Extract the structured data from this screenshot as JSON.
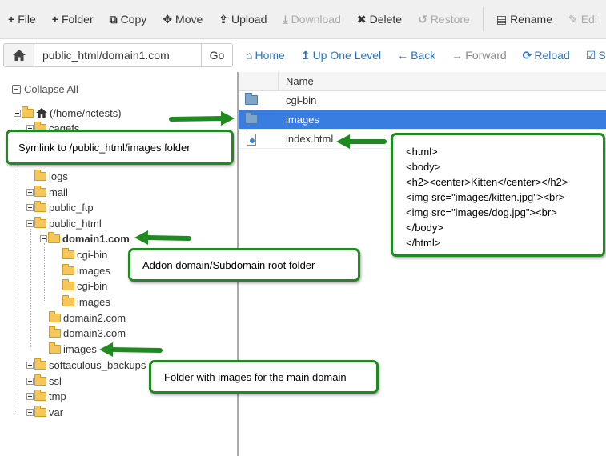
{
  "toolbar": {
    "file": "File",
    "folder": "Folder",
    "copy": "Copy",
    "move": "Move",
    "upload": "Upload",
    "download": "Download",
    "delete": "Delete",
    "restore": "Restore",
    "rename": "Rename",
    "edit": "Edi"
  },
  "address": {
    "path": "public_html/domain1.com",
    "go": "Go"
  },
  "nav": {
    "home": "Home",
    "up": "Up One Level",
    "back": "Back",
    "forward": "Forward",
    "reload": "Reload",
    "select": "Sel"
  },
  "tree": {
    "collapse_all": "Collapse All",
    "root": "(/home/nctests)",
    "cagefs": "cagefs",
    "logs": "logs",
    "mail": "mail",
    "public_ftp": "public_ftp",
    "public_html": "public_html",
    "domain1": "domain1.com",
    "cgi_bin_1": "cgi-bin",
    "images_1": "images",
    "cgi_bin_2": "cgi-bin",
    "images_2": "images",
    "domain2": "domain2.com",
    "domain3": "domain3.com",
    "images_main": "images",
    "softaculous": "softaculous_backups",
    "ssl": "ssl",
    "tmp": "tmp",
    "var": "var"
  },
  "filelist": {
    "header_name": "Name",
    "rows": [
      {
        "name": "cgi-bin",
        "type": "folder"
      },
      {
        "name": "images",
        "type": "folder"
      },
      {
        "name": "index.html",
        "type": "file"
      }
    ]
  },
  "callouts": {
    "symlink": "Symlink to /public_html/images folder",
    "addon": "Addon domain/Subdomain root folder",
    "main_images": "Folder with images for the main domain",
    "code": [
      "<html>",
      "<body>",
      "<h2><center>Kitten</center></h2>",
      "<img src=\"images/kitten.jpg\"><br>",
      "<img src=\"images/dog.jpg\"><br>",
      "</body>",
      "</html>"
    ]
  },
  "colors": {
    "selected_row": "#3a7de0",
    "link": "#2a73c4",
    "callout_border": "#1f8a1f"
  }
}
